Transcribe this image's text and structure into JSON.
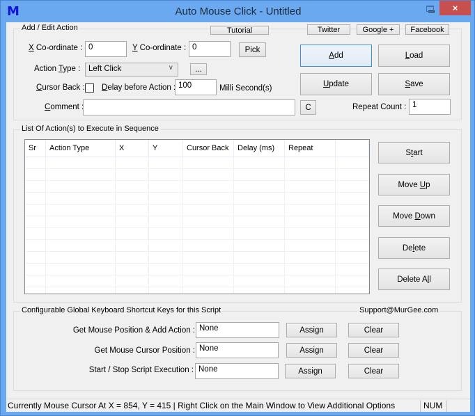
{
  "window": {
    "app_icon": "M",
    "title": "Auto Mouse Click - Untitled",
    "minimize_icon": "minimize-icon",
    "maximize_icon": "maximize-icon",
    "close_icon": "×"
  },
  "add_edit": {
    "group_label": "Add / Edit Action",
    "tutorial_label": "Tutorial",
    "twitter_label": "Twitter",
    "google_label": "Google +",
    "facebook_label": "Facebook",
    "x_label_key": "X",
    "x_label_rest": " Co-ordinate :",
    "x_value": "0",
    "y_label_key": "Y",
    "y_label_rest": " Co-ordinate :",
    "y_value": "0",
    "pick_label": "Pick",
    "action_type_label_pre": "Action ",
    "action_type_label_key": "T",
    "action_type_label_rest": "ype :",
    "action_type_value": "Left Click",
    "more_label": "...",
    "cursor_back_label_key": "C",
    "cursor_back_label_rest": "ursor Back :",
    "cursor_back_checked": false,
    "delay_label_key": "D",
    "delay_label_rest": "elay before Action :",
    "delay_value": "100",
    "delay_unit": "Milli Second(s)",
    "comment_label_key": "C",
    "comment_label_rest": "omment :",
    "comment_value": "",
    "clear_comment_label": "C",
    "repeat_label": "Repeat Count :",
    "repeat_value": "1",
    "add_key": "A",
    "add_rest": "dd",
    "load_key": "L",
    "load_rest": "oad",
    "update_key": "U",
    "update_rest": "pdate",
    "save_key": "S",
    "save_rest": "ave"
  },
  "list": {
    "group_label": "List Of Action(s) to Execute in Sequence",
    "columns": [
      "Sr",
      "Action Type",
      "X",
      "Y",
      "Cursor Back",
      "Delay (ms)",
      "Repeat",
      ""
    ],
    "rows": [],
    "start_pre": "S",
    "start_key": "t",
    "start_rest": "art",
    "moveup_pre": "Move ",
    "moveup_key": "U",
    "moveup_rest": "p",
    "movedown_pre": "Move ",
    "movedown_key": "D",
    "movedown_rest": "own",
    "delete_pre": "De",
    "delete_key": "l",
    "delete_rest": "ete",
    "deleteall_pre": "Delete A",
    "deleteall_key": "l",
    "deleteall_rest": "l"
  },
  "shortcuts": {
    "group_label": "Configurable Global Keyboard Shortcut Keys for this Script",
    "support": "Support@MurGee.com",
    "items": [
      {
        "label": "Get Mouse Position & Add Action :",
        "value": "None",
        "assign": "Assign",
        "clear": "Clear"
      },
      {
        "label": "Get Mouse Cursor Position :",
        "value": "None",
        "assign": "Assign",
        "clear": "Clear"
      },
      {
        "label": "Start / Stop Script Execution :",
        "value": "None",
        "assign": "Assign",
        "clear": "Clear"
      }
    ]
  },
  "status": {
    "text": "Currently Mouse Cursor At X = 854, Y = 415 | Right Click on the Main Window to View Additional Options",
    "num": "NUM"
  }
}
